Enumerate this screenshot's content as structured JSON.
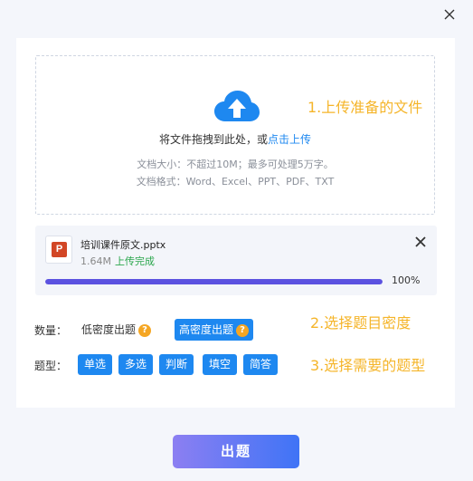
{
  "dialog": {
    "close_icon": "close-icon"
  },
  "upload": {
    "drop_text": "将文件拖拽到此处，或",
    "upload_link": "点击上传",
    "size_hint": "文档大小：不超过10M；最多可处理5万字。",
    "format_hint": "文档格式：Word、Excel、PPT、PDF、TXT",
    "cloud_icon": "cloud-upload-icon",
    "icon_color": "#1e88f0"
  },
  "annotations": {
    "step1": "1.上传准备的文件",
    "step2": "2.选择题目密度",
    "step3": "3.选择需要的题型",
    "color": "#f5b52a"
  },
  "file": {
    "icon": "ppt-file-icon",
    "icon_letter": "P",
    "name": "培训课件原文.pptx",
    "size": "1.64M",
    "status": "上传完成",
    "progress": 1.0,
    "progress_label": "100%",
    "remove_icon": "close-icon"
  },
  "density": {
    "label": "数量：",
    "options": [
      {
        "label": "低密度出题",
        "selected": false
      },
      {
        "label": "高密度出题",
        "selected": true
      }
    ],
    "help_icon": "question-mark-icon",
    "help_glyph": "?"
  },
  "question_types": {
    "label": "题型：",
    "options": [
      "单选",
      "多选",
      "判断",
      "填空",
      "简答"
    ]
  },
  "submit": {
    "label": "出题"
  }
}
